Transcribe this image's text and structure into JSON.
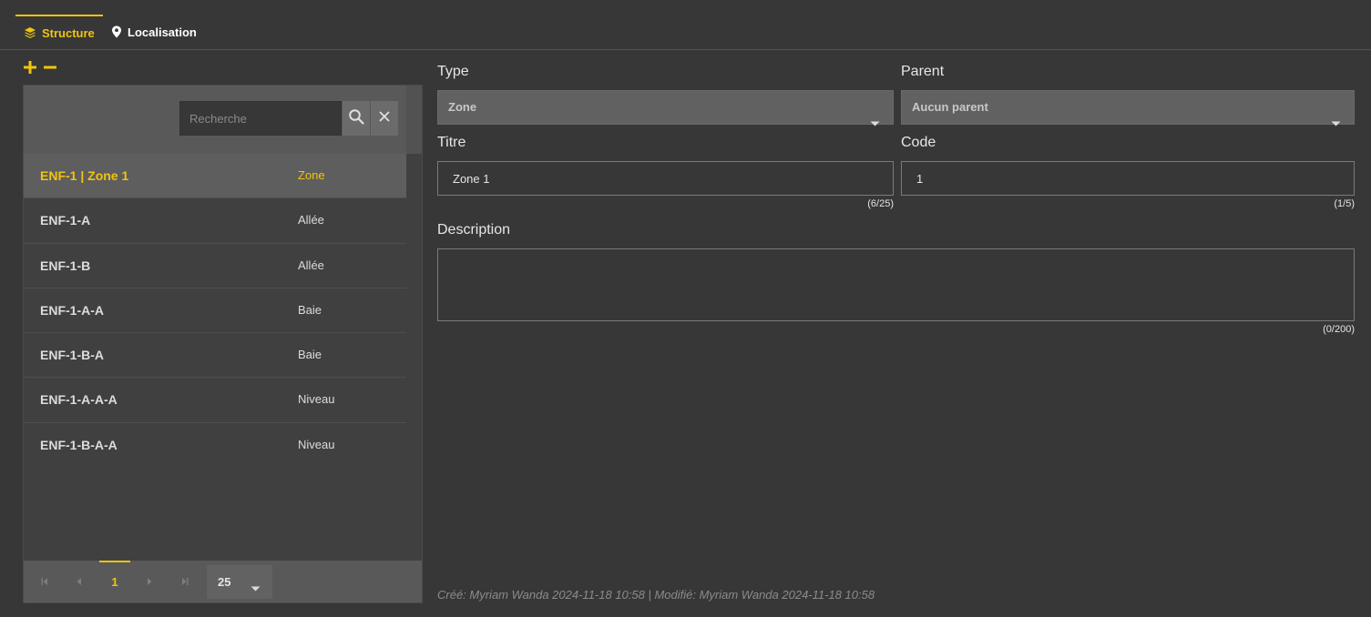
{
  "tabs": [
    {
      "label": "Structure",
      "icon": "layers-icon",
      "active": true
    },
    {
      "label": "Localisation",
      "icon": "map-pin-icon",
      "active": false
    }
  ],
  "colors": {
    "accent": "#f1c40f",
    "background": "#373737",
    "panel": "#404040",
    "header": "#595959"
  },
  "list": {
    "search_placeholder": "Recherche",
    "rows": [
      {
        "name": "ENF-1 | Zone 1",
        "type": "Zone",
        "selected": true
      },
      {
        "name": "ENF-1-A",
        "type": "Allée",
        "selected": false
      },
      {
        "name": "ENF-1-B",
        "type": "Allée",
        "selected": false
      },
      {
        "name": "ENF-1-A-A",
        "type": "Baie",
        "selected": false
      },
      {
        "name": "ENF-1-B-A",
        "type": "Baie",
        "selected": false
      },
      {
        "name": "ENF-1-A-A-A",
        "type": "Niveau",
        "selected": false
      },
      {
        "name": "ENF-1-B-A-A",
        "type": "Niveau",
        "selected": false
      }
    ],
    "pager": {
      "current_page": "1",
      "page_size": "25"
    }
  },
  "form": {
    "type_label": "Type",
    "type_value": "Zone",
    "parent_label": "Parent",
    "parent_value": "Aucun parent",
    "title_label": "Titre",
    "title_value": "Zone 1",
    "title_counter": "(6/25)",
    "code_label": "Code",
    "code_value": "1",
    "code_counter": "(1/5)",
    "description_label": "Description",
    "description_value": "",
    "description_counter": "(0/200)",
    "meta": "Créé: Myriam Wanda 2024-11-18 10:58 | Modifié: Myriam Wanda 2024-11-18 10:58"
  }
}
